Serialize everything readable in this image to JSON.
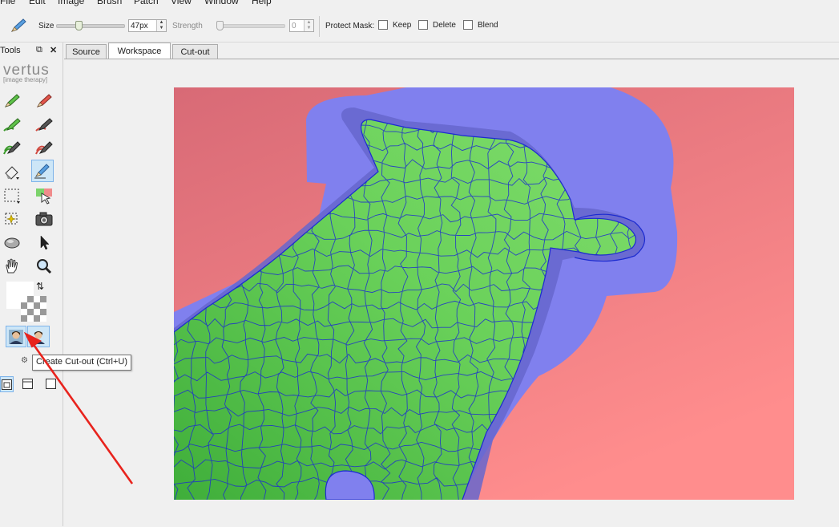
{
  "menu": [
    "File",
    "Edit",
    "Image",
    "Brush",
    "Patch",
    "View",
    "Window",
    "Help"
  ],
  "toolbar": {
    "size_label": "Size",
    "size_value": "47px",
    "strength_label": "Strength",
    "strength_value": "0",
    "protect_label": "Protect Mask:",
    "keep_label": "Keep",
    "delete_label": "Delete",
    "blend_label": "Blend"
  },
  "tools_panel": {
    "title": "Tools",
    "logo": "vertus",
    "logo_sub": "[image therapy]"
  },
  "tabs": [
    {
      "label": "Source",
      "active": false
    },
    {
      "label": "Workspace",
      "active": true
    },
    {
      "label": "Cut-out",
      "active": false
    }
  ],
  "tooltip": "Create Cut-out (Ctrl+U)",
  "colors": {
    "background_mask": "#e8727e",
    "buffer_mask": "#8484ee",
    "foreground_mask": "#5ccc4e",
    "segment_lines": "#1c2bd0",
    "arrow": "#e8231d"
  }
}
